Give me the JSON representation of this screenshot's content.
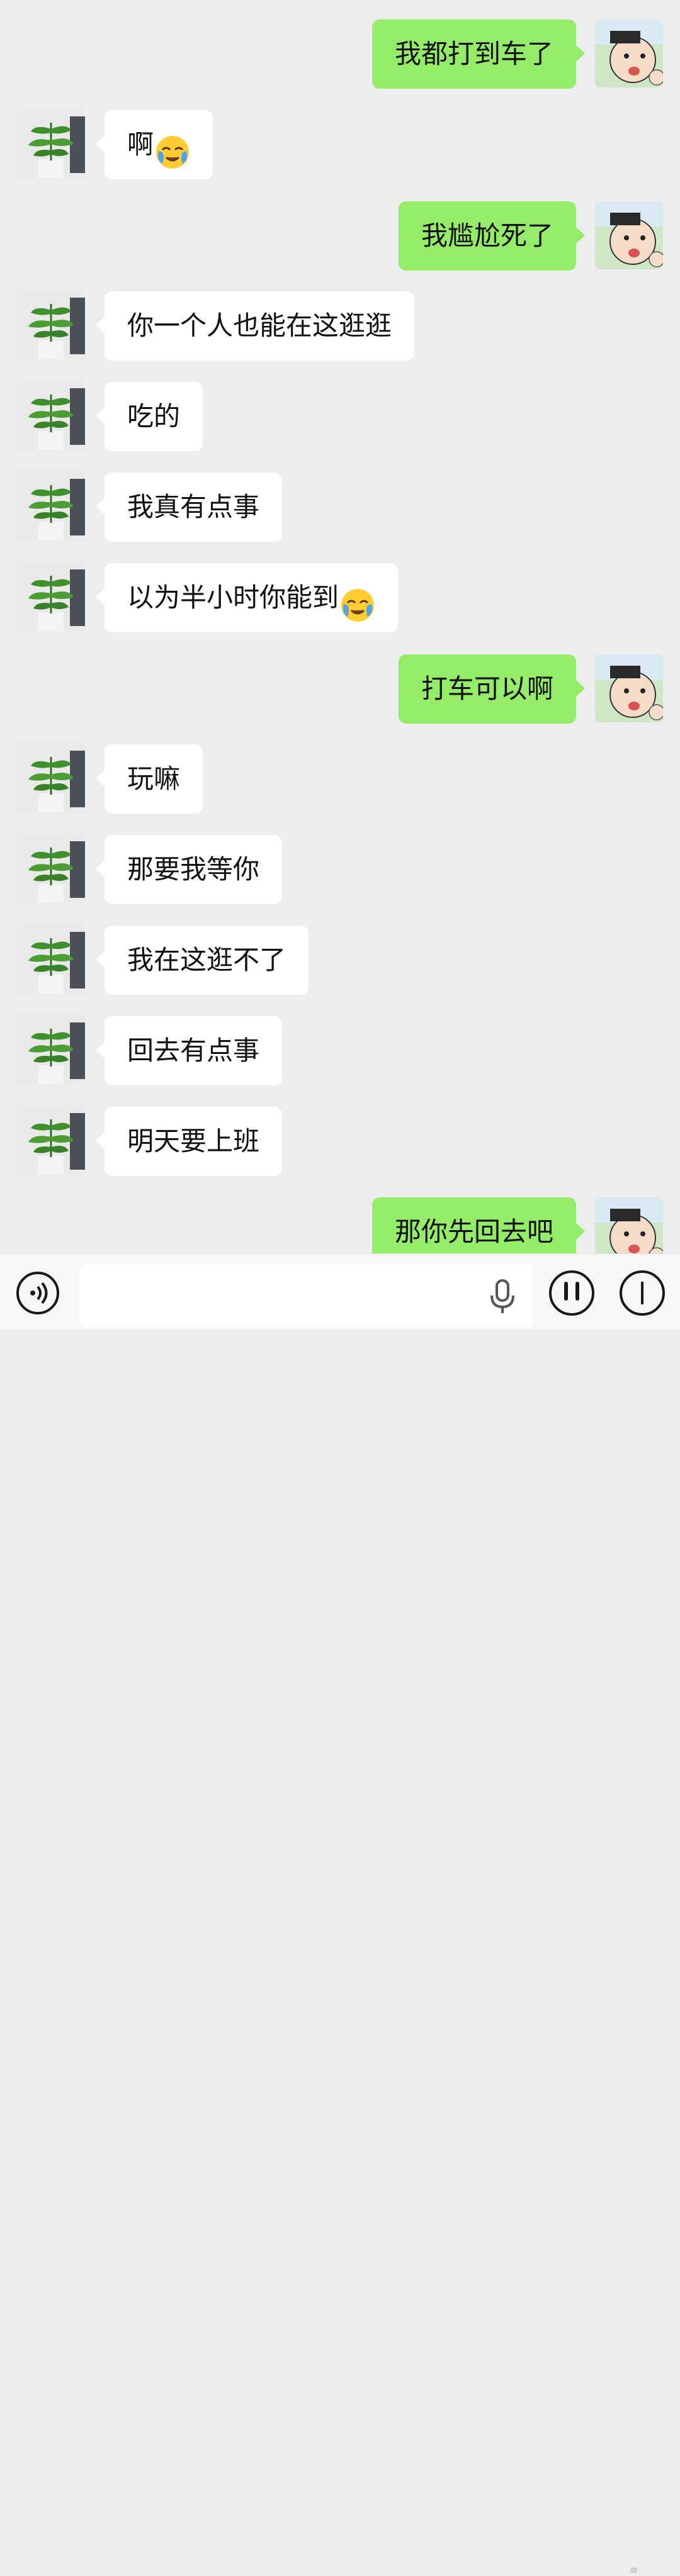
{
  "messages": [
    {
      "side": "right",
      "text": "我都打到车了"
    },
    {
      "side": "left",
      "text": "啊",
      "emoji": "face-with-tears-emoji"
    },
    {
      "side": "right",
      "text": "我尴尬死了"
    },
    {
      "side": "left",
      "text": "你一个人也能在这逛逛"
    },
    {
      "side": "left",
      "text": "吃的"
    },
    {
      "side": "left",
      "text": "我真有点事"
    },
    {
      "side": "left",
      "text": "以为半小时你能到",
      "emoji": "face-with-tears-emoji"
    },
    {
      "side": "right",
      "text": "打车可以啊"
    },
    {
      "side": "left",
      "text": "玩嘛"
    },
    {
      "side": "left",
      "text": "那要我等你"
    },
    {
      "side": "left",
      "text": "我在这逛不了"
    },
    {
      "side": "left",
      "text": "回去有点事"
    },
    {
      "side": "left",
      "text": "明天要上班"
    },
    {
      "side": "right",
      "text": "那你先回去吧"
    }
  ],
  "avatars": {
    "contact": "plant-avatar",
    "self": "cartoon-boy-avatar"
  },
  "input_bar": {
    "placeholder": "",
    "voice_icon": "voice-icon",
    "mic_icon": "mic-icon",
    "emoji_icon": "emoji-face-icon",
    "more_icon": "plus-icon"
  },
  "colors": {
    "background": "#ededed",
    "bubble_self": "#95ec69",
    "bubble_contact": "#ffffff"
  }
}
